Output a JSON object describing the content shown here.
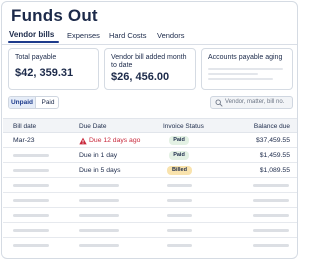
{
  "page": {
    "title": "Funds Out"
  },
  "tabs": [
    {
      "label": "Vendor bills",
      "active": true
    },
    {
      "label": "Expenses",
      "active": false
    },
    {
      "label": "Hard Costs",
      "active": false
    },
    {
      "label": "Vendors",
      "active": false
    }
  ],
  "summary": {
    "total_payable": {
      "label": "Total payable",
      "value": "$42, 359.31"
    },
    "vendor_bill_added": {
      "label": "Vendor bill added month to date",
      "value": "$26, 456.00"
    },
    "aging": {
      "label": "Accounts payable aging"
    }
  },
  "filter": {
    "options": [
      "Unpaid",
      "Paid"
    ],
    "selected": "Unpaid"
  },
  "search": {
    "placeholder": "Vendor, matter, bill no."
  },
  "table": {
    "columns": [
      "Bill date",
      "Due Date",
      "Invoice Status",
      "Balance due"
    ],
    "rows": [
      {
        "bill_date": "Mar-23",
        "due_date": "Due 12 days ago",
        "overdue": true,
        "status": "Paid",
        "balance": "$37,459.55"
      },
      {
        "bill_date": "",
        "due_date": "Due in 1 day",
        "overdue": false,
        "status": "Paid",
        "balance": "$1,459.55"
      },
      {
        "bill_date": "",
        "due_date": "Due in 5 days",
        "overdue": false,
        "status": "Billed",
        "balance": "$1,089.55"
      }
    ]
  },
  "colors": {
    "accent": "#1d3b8c",
    "overdue": "#c8283b",
    "paid_badge": "#e3f1e4",
    "billed_badge": "#f9e3ad"
  }
}
